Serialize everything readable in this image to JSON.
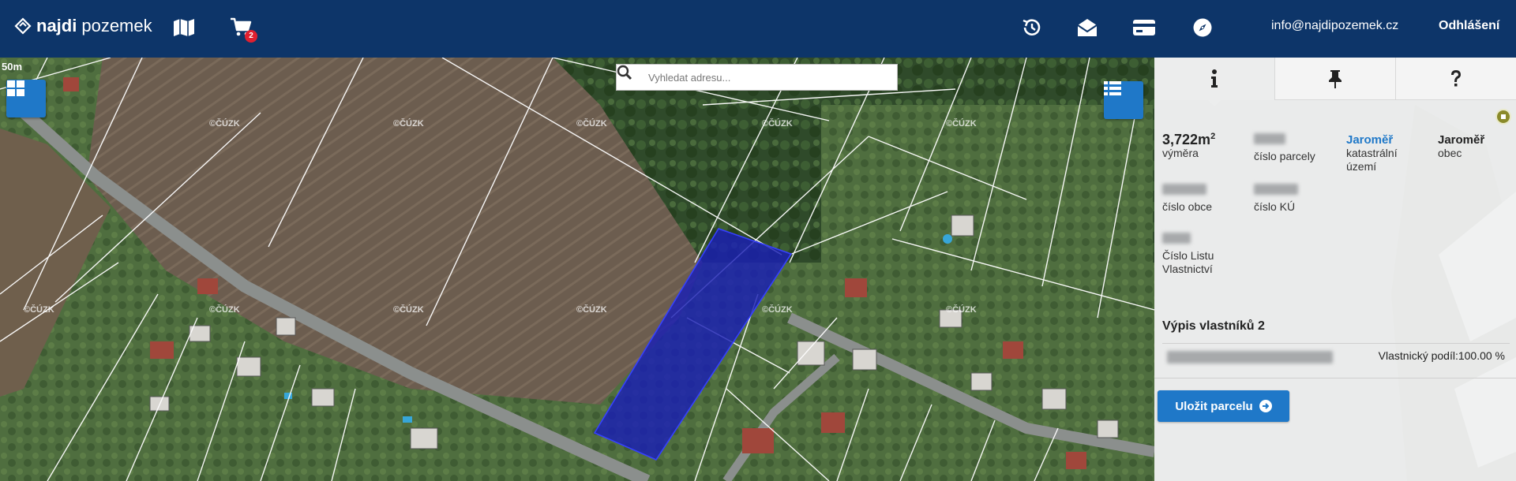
{
  "header": {
    "logo": {
      "bold": "najdi",
      "regular": "pozemek"
    },
    "map_icon": "map-icon",
    "cart": {
      "icon": "cart-icon",
      "badge": "2"
    },
    "history_icon": "history-icon",
    "mail_icon": "envelope-open-icon",
    "card_icon": "credit-card-icon",
    "compass_icon": "compass-icon",
    "email": "info@najdipozemek.cz",
    "logout": "Odhlášení"
  },
  "map": {
    "scale_label": "50m",
    "search_placeholder": "Vyhledat adresu...",
    "watermark": "©ČÚZK",
    "layers_button": "grid-icon",
    "list_button": "list-icon"
  },
  "panel": {
    "tabs": [
      {
        "icon": "info-icon",
        "active": true
      },
      {
        "icon": "pin-icon",
        "active": false
      },
      {
        "icon": "question-icon",
        "active": false
      }
    ],
    "area_value": "3,722m",
    "area_sup": "2",
    "area_label": "výměra",
    "parcel_label": "číslo parcely",
    "cadastral_value": "Jaroměř",
    "cadastral_label": "katastrální území",
    "municipality_value": "Jaroměř",
    "municipality_label": "obec",
    "municipality_no_label": "číslo obce",
    "ku_no_label": "číslo KÚ",
    "lv_label": "Číslo Listu Vlastnictví",
    "owners_title": "Výpis vlastníků 2",
    "owner_share": "Vlastnický podíl:100.00 %",
    "save_button": "Uložit parcelu"
  },
  "colors": {
    "header_bg": "#0d3569",
    "accent": "#1f78c8",
    "parcel_fill": "#1a1fb5"
  }
}
